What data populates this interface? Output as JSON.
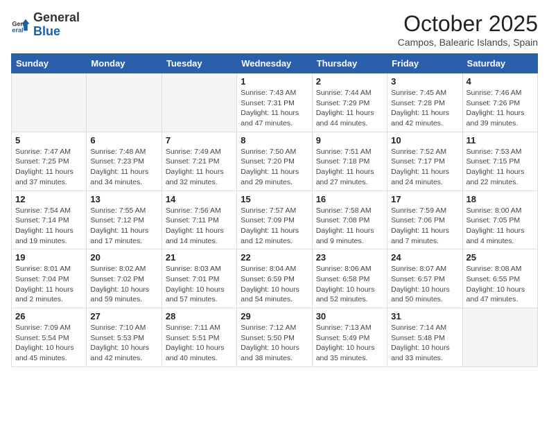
{
  "header": {
    "logo_general": "General",
    "logo_blue": "Blue",
    "month": "October 2025",
    "location": "Campos, Balearic Islands, Spain"
  },
  "weekdays": [
    "Sunday",
    "Monday",
    "Tuesday",
    "Wednesday",
    "Thursday",
    "Friday",
    "Saturday"
  ],
  "weeks": [
    [
      {
        "day": "",
        "empty": true
      },
      {
        "day": "",
        "empty": true
      },
      {
        "day": "",
        "empty": true
      },
      {
        "day": "1",
        "sunrise": "7:43 AM",
        "sunset": "7:31 PM",
        "daylight": "11 hours and 47 minutes."
      },
      {
        "day": "2",
        "sunrise": "7:44 AM",
        "sunset": "7:29 PM",
        "daylight": "11 hours and 44 minutes."
      },
      {
        "day": "3",
        "sunrise": "7:45 AM",
        "sunset": "7:28 PM",
        "daylight": "11 hours and 42 minutes."
      },
      {
        "day": "4",
        "sunrise": "7:46 AM",
        "sunset": "7:26 PM",
        "daylight": "11 hours and 39 minutes."
      }
    ],
    [
      {
        "day": "5",
        "sunrise": "7:47 AM",
        "sunset": "7:25 PM",
        "daylight": "11 hours and 37 minutes."
      },
      {
        "day": "6",
        "sunrise": "7:48 AM",
        "sunset": "7:23 PM",
        "daylight": "11 hours and 34 minutes."
      },
      {
        "day": "7",
        "sunrise": "7:49 AM",
        "sunset": "7:21 PM",
        "daylight": "11 hours and 32 minutes."
      },
      {
        "day": "8",
        "sunrise": "7:50 AM",
        "sunset": "7:20 PM",
        "daylight": "11 hours and 29 minutes."
      },
      {
        "day": "9",
        "sunrise": "7:51 AM",
        "sunset": "7:18 PM",
        "daylight": "11 hours and 27 minutes."
      },
      {
        "day": "10",
        "sunrise": "7:52 AM",
        "sunset": "7:17 PM",
        "daylight": "11 hours and 24 minutes."
      },
      {
        "day": "11",
        "sunrise": "7:53 AM",
        "sunset": "7:15 PM",
        "daylight": "11 hours and 22 minutes."
      }
    ],
    [
      {
        "day": "12",
        "sunrise": "7:54 AM",
        "sunset": "7:14 PM",
        "daylight": "11 hours and 19 minutes."
      },
      {
        "day": "13",
        "sunrise": "7:55 AM",
        "sunset": "7:12 PM",
        "daylight": "11 hours and 17 minutes."
      },
      {
        "day": "14",
        "sunrise": "7:56 AM",
        "sunset": "7:11 PM",
        "daylight": "11 hours and 14 minutes."
      },
      {
        "day": "15",
        "sunrise": "7:57 AM",
        "sunset": "7:09 PM",
        "daylight": "11 hours and 12 minutes."
      },
      {
        "day": "16",
        "sunrise": "7:58 AM",
        "sunset": "7:08 PM",
        "daylight": "11 hours and 9 minutes."
      },
      {
        "day": "17",
        "sunrise": "7:59 AM",
        "sunset": "7:06 PM",
        "daylight": "11 hours and 7 minutes."
      },
      {
        "day": "18",
        "sunrise": "8:00 AM",
        "sunset": "7:05 PM",
        "daylight": "11 hours and 4 minutes."
      }
    ],
    [
      {
        "day": "19",
        "sunrise": "8:01 AM",
        "sunset": "7:04 PM",
        "daylight": "11 hours and 2 minutes."
      },
      {
        "day": "20",
        "sunrise": "8:02 AM",
        "sunset": "7:02 PM",
        "daylight": "10 hours and 59 minutes."
      },
      {
        "day": "21",
        "sunrise": "8:03 AM",
        "sunset": "7:01 PM",
        "daylight": "10 hours and 57 minutes."
      },
      {
        "day": "22",
        "sunrise": "8:04 AM",
        "sunset": "6:59 PM",
        "daylight": "10 hours and 54 minutes."
      },
      {
        "day": "23",
        "sunrise": "8:06 AM",
        "sunset": "6:58 PM",
        "daylight": "10 hours and 52 minutes."
      },
      {
        "day": "24",
        "sunrise": "8:07 AM",
        "sunset": "6:57 PM",
        "daylight": "10 hours and 50 minutes."
      },
      {
        "day": "25",
        "sunrise": "8:08 AM",
        "sunset": "6:55 PM",
        "daylight": "10 hours and 47 minutes."
      }
    ],
    [
      {
        "day": "26",
        "sunrise": "7:09 AM",
        "sunset": "5:54 PM",
        "daylight": "10 hours and 45 minutes."
      },
      {
        "day": "27",
        "sunrise": "7:10 AM",
        "sunset": "5:53 PM",
        "daylight": "10 hours and 42 minutes."
      },
      {
        "day": "28",
        "sunrise": "7:11 AM",
        "sunset": "5:51 PM",
        "daylight": "10 hours and 40 minutes."
      },
      {
        "day": "29",
        "sunrise": "7:12 AM",
        "sunset": "5:50 PM",
        "daylight": "10 hours and 38 minutes."
      },
      {
        "day": "30",
        "sunrise": "7:13 AM",
        "sunset": "5:49 PM",
        "daylight": "10 hours and 35 minutes."
      },
      {
        "day": "31",
        "sunrise": "7:14 AM",
        "sunset": "5:48 PM",
        "daylight": "10 hours and 33 minutes."
      },
      {
        "day": "",
        "empty": true
      }
    ]
  ]
}
